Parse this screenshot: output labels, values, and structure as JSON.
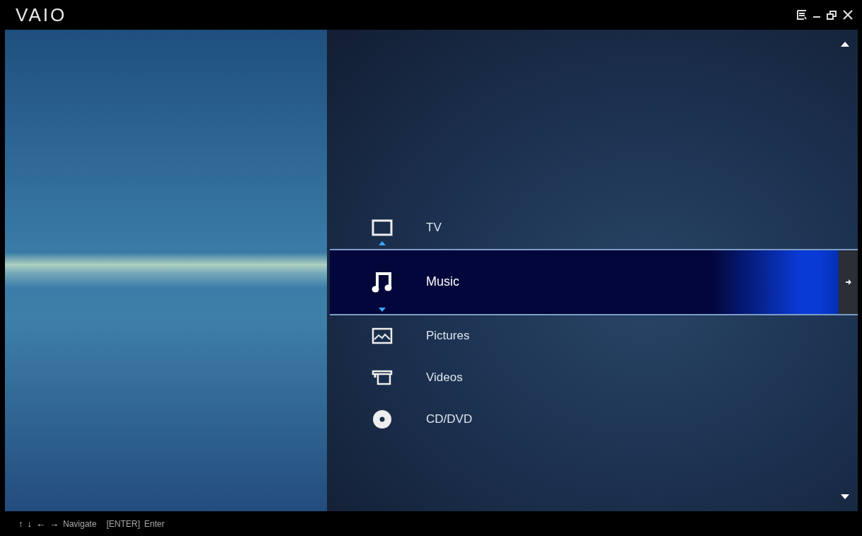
{
  "window": {
    "logo": "VAIO"
  },
  "menu": [
    {
      "kind": "tv",
      "label": "TV",
      "selected": false
    },
    {
      "kind": "music",
      "label": "Music",
      "selected": true
    },
    {
      "kind": "pictures",
      "label": "Pictures",
      "selected": false
    },
    {
      "kind": "videos",
      "label": "Videos",
      "selected": false
    },
    {
      "kind": "disc",
      "label": "CD/DVD",
      "selected": false
    }
  ],
  "status_bar": {
    "keys": [
      "↑",
      "↓",
      "←",
      "→"
    ],
    "navigate": "Navigate",
    "enter_key": "[ENTER]",
    "enter": "Enter"
  }
}
